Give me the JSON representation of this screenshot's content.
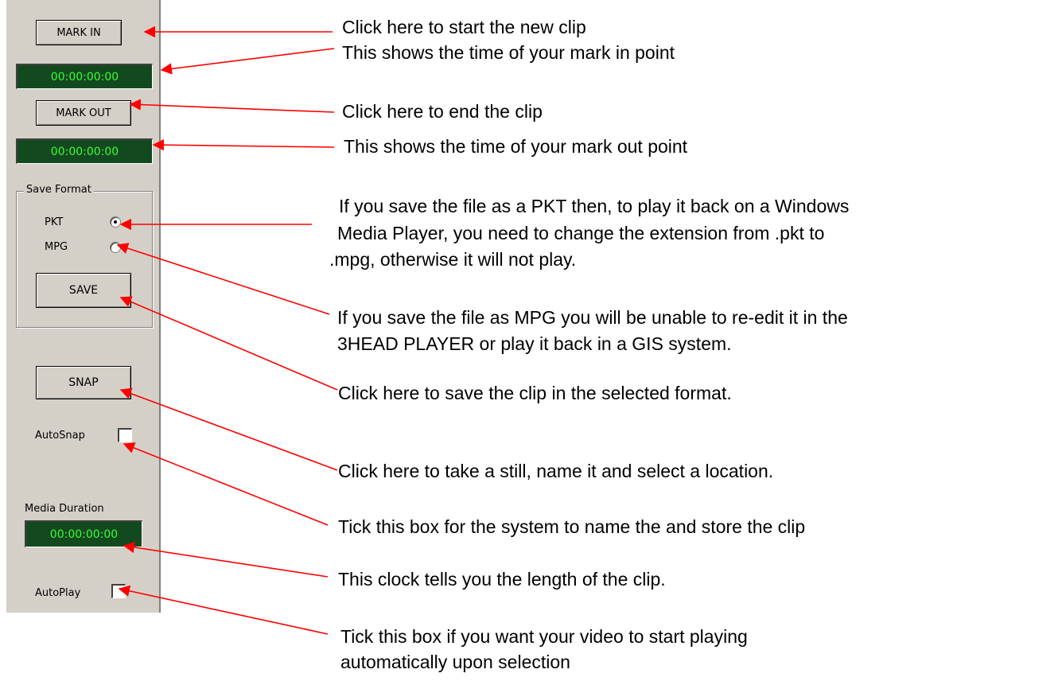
{
  "panel": {
    "mark_in_label": "MARK IN",
    "mark_in_time": "00:00:00:00",
    "mark_out_label": "MARK OUT",
    "mark_out_time": "00:00:00:00",
    "save_format_title": "Save Format",
    "pkt_label": "PKT",
    "mpg_label": "MPG",
    "pkt_selected": true,
    "save_label": "SAVE",
    "snap_label": "SNAP",
    "autosnap_label": "AutoSnap",
    "media_duration_label": "Media Duration",
    "media_duration_time": "00:00:00:00",
    "autoplay_label": "AutoPlay"
  },
  "annotations": {
    "mark_in_line1": "Click here to start the new clip",
    "mark_in_line2": "This shows the time of your mark in point",
    "mark_out_line1": "Click here to end the clip",
    "mark_out_line2": "This shows the time of your mark out point",
    "pkt_line1": "If you save the file as a PKT then, to play it back on a Windows",
    "pkt_line2": "Media Player, you need to change the extension from .pkt to",
    "pkt_line3": ".mpg, otherwise it will not play.",
    "mpg_line1": "If you save the file as MPG you will be unable to re-edit it in the",
    "mpg_line2": "3HEAD PLAYER or play it back in a GIS system.",
    "save": "Click here to save the clip in the selected format.",
    "snap": "Click here to take a still, name it and select a location.",
    "autosnap": "Tick this box for the system to name the and store the clip",
    "duration": "This clock tells you the length of the clip.",
    "autoplay_line1": "Tick this box if you want your video to start playing",
    "autoplay_line2": "automatically upon selection"
  },
  "colors": {
    "panel_bg": "#d4d0c8",
    "lcd_bg": "#13491e",
    "lcd_text": "#39ff39",
    "arrow": "#ff0000"
  }
}
